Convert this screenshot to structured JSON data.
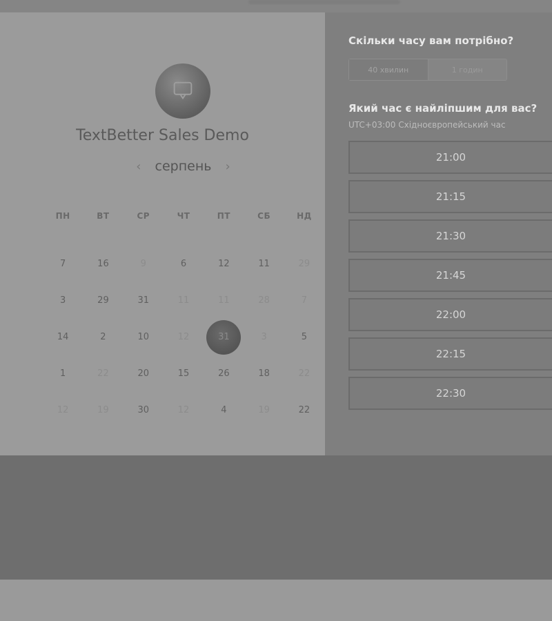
{
  "calendar": {
    "title": "TextBetter Sales Demo",
    "month": "серпень",
    "prev_icon": "‹",
    "next_icon": "›",
    "weekdays": [
      "ПН",
      "ВТ",
      "СР",
      "ЧТ",
      "ПТ",
      "СБ",
      "НД"
    ],
    "days": [
      [
        "7",
        "16",
        "9",
        "6",
        "12",
        "11",
        "29"
      ],
      [
        "3",
        "29",
        "31",
        "11",
        "11",
        "28",
        "7"
      ],
      [
        "14",
        "2",
        "10",
        "12",
        "31",
        "3",
        "5"
      ],
      [
        "1",
        "22",
        "20",
        "15",
        "26",
        "18",
        "22"
      ],
      [
        "12",
        "19",
        "30",
        "12",
        "4",
        "19",
        "22"
      ]
    ]
  },
  "booking": {
    "duration_question": "Скільки часу вам потрібно?",
    "duration_options": [
      "40 хвилин",
      "1 годин"
    ],
    "time_question": "Який час є найліпшим для вас?",
    "timezone": "UTC+03:00 Східноєвропейський час",
    "slots": [
      "21:00",
      "21:15",
      "21:30",
      "21:45",
      "22:00",
      "22:15",
      "22:30"
    ]
  },
  "colors": {
    "page_bg": "#9b9b9b",
    "panel_bg": "#7f7f7f",
    "footer_bg": "#6e6e6e"
  }
}
